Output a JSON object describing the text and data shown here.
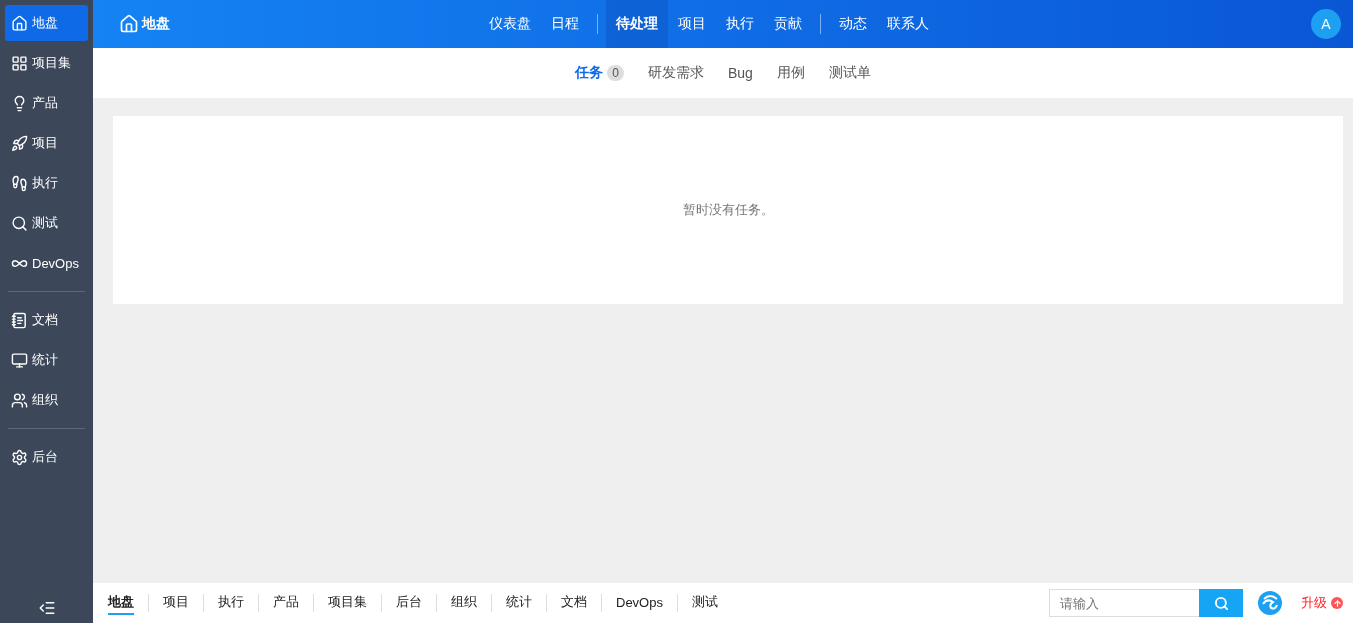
{
  "sidebar": {
    "groups": [
      [
        {
          "label": "地盘",
          "selected": true
        },
        {
          "label": "项目集",
          "selected": false
        },
        {
          "label": "产品",
          "selected": false
        },
        {
          "label": "项目",
          "selected": false
        },
        {
          "label": "执行",
          "selected": false
        },
        {
          "label": "测试",
          "selected": false
        },
        {
          "label": "DevOps",
          "selected": false
        }
      ],
      [
        {
          "label": "文档",
          "selected": false
        },
        {
          "label": "统计",
          "selected": false
        },
        {
          "label": "组织",
          "selected": false
        }
      ],
      [
        {
          "label": "后台",
          "selected": false
        }
      ]
    ]
  },
  "header": {
    "title": "地盘",
    "nav_groups": [
      [
        {
          "label": "仪表盘",
          "selected": false
        },
        {
          "label": "日程",
          "selected": false
        }
      ],
      [
        {
          "label": "待处理",
          "selected": true
        },
        {
          "label": "项目",
          "selected": false
        },
        {
          "label": "执行",
          "selected": false
        },
        {
          "label": "贡献",
          "selected": false
        }
      ],
      [
        {
          "label": "动态",
          "selected": false
        },
        {
          "label": "联系人",
          "selected": false
        }
      ]
    ],
    "avatar": "A"
  },
  "subtabs": [
    {
      "label": "任务",
      "count": "0",
      "selected": true
    },
    {
      "label": "研发需求",
      "selected": false
    },
    {
      "label": "Bug",
      "selected": false
    },
    {
      "label": "用例",
      "selected": false
    },
    {
      "label": "测试单",
      "selected": false
    }
  ],
  "empty_message": "暂时没有任务。",
  "footer": {
    "nav": [
      {
        "label": "地盘",
        "selected": true
      },
      {
        "label": "项目",
        "selected": false
      },
      {
        "label": "执行",
        "selected": false
      },
      {
        "label": "产品",
        "selected": false
      },
      {
        "label": "项目集",
        "selected": false
      },
      {
        "label": "后台",
        "selected": false
      },
      {
        "label": "组织",
        "selected": false
      },
      {
        "label": "统计",
        "selected": false
      },
      {
        "label": "文档",
        "selected": false
      },
      {
        "label": "DevOps",
        "selected": false
      },
      {
        "label": "测试",
        "selected": false
      }
    ],
    "search": {
      "placeholder": "请输入"
    },
    "upgrade": "升级"
  }
}
